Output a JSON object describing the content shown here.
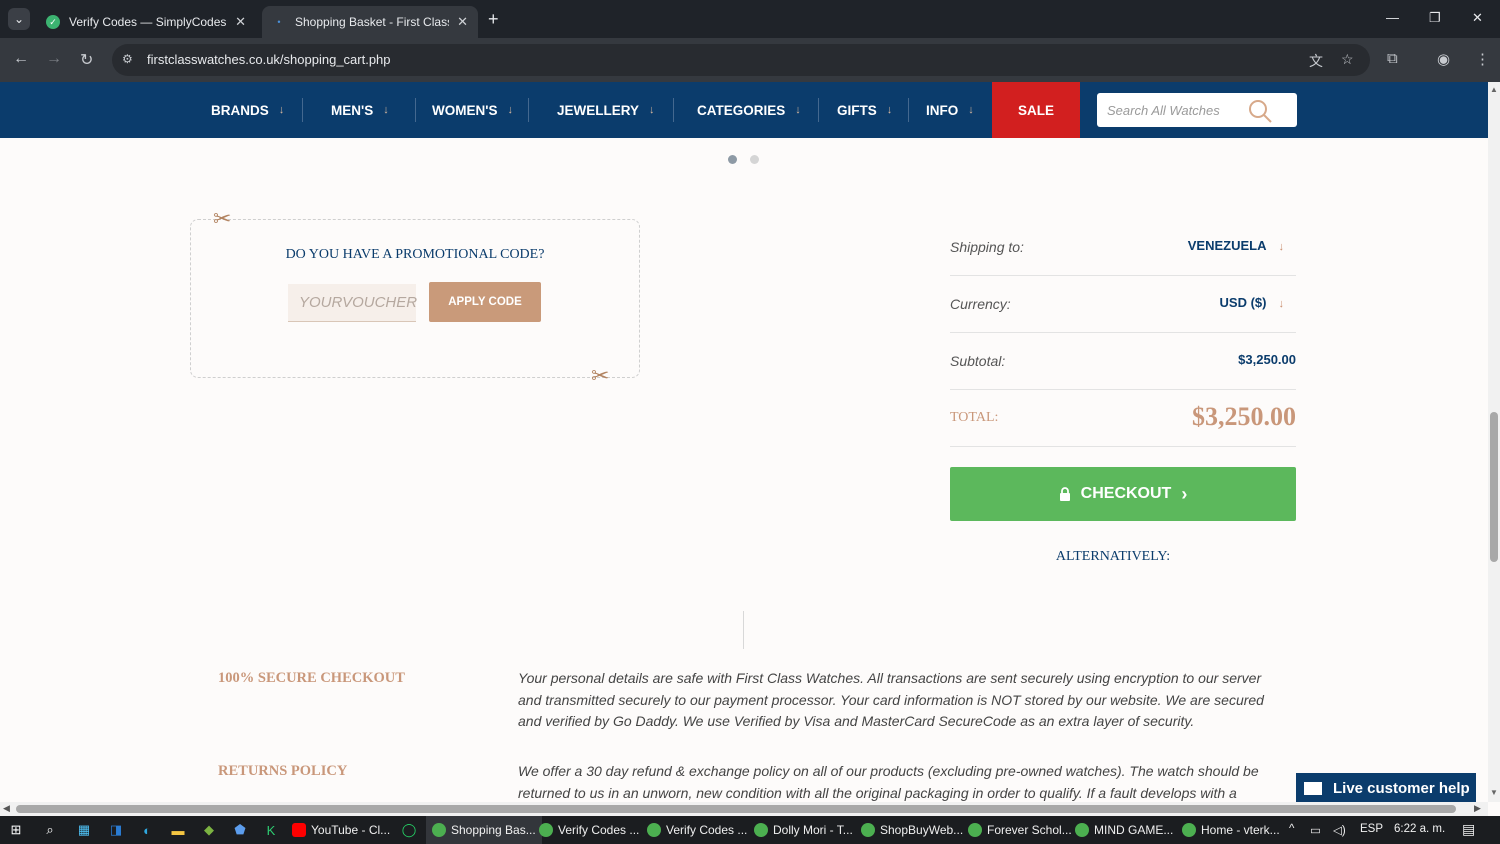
{
  "browser": {
    "tabs": [
      {
        "title": "Verify Codes — SimplyCodes",
        "active": false
      },
      {
        "title": "Shopping Basket - First Class W",
        "active": true
      }
    ],
    "url": "firstclasswatches.co.uk/shopping_cart.php"
  },
  "site_nav": {
    "items": [
      {
        "label": "BRANDS"
      },
      {
        "label": "MEN'S"
      },
      {
        "label": "WOMEN'S"
      },
      {
        "label": "JEWELLERY"
      },
      {
        "label": "CATEGORIES"
      },
      {
        "label": "GIFTS"
      },
      {
        "label": "INFO"
      }
    ],
    "sale_label": "SALE",
    "search_placeholder": "Search All Watches",
    "colors": {
      "nav_bg": "#0b3c6c",
      "sale_bg": "#d21f1f"
    }
  },
  "promo": {
    "title": "DO YOU HAVE A PROMOTIONAL CODE?",
    "voucher_placeholder": "YOURVOUCHER",
    "apply_label": "APPLY CODE"
  },
  "summary": {
    "shipping_label": "Shipping to:",
    "shipping_value": "VENEZUELA",
    "currency_label": "Currency:",
    "currency_value": "USD ($)",
    "subtotal_label": "Subtotal:",
    "subtotal_value": "$3,250.00",
    "total_label": "TOTAL:",
    "total_value": "$3,250.00"
  },
  "checkout": {
    "label": "CHECKOUT",
    "alternatively": "ALTERNATIVELY:",
    "color": "#5cb85c"
  },
  "info": [
    {
      "heading": "100% SECURE CHECKOUT",
      "text": "Your personal details are safe with First Class Watches. All transactions are sent securely using encryption to our server and transmitted securely to our payment processor. Your card information is NOT stored by our website. We are secured and verified by Go Daddy. We use Verified by Visa and MasterCard SecureCode as an extra layer of security."
    },
    {
      "heading": "RETURNS POLICY",
      "text": "We offer a 30 day refund & exchange policy on all of our products (excluding pre-owned watches). The watch should be returned to us in an unworn, new condition with all the original packaging in order to qualify. If a fault develops with a"
    }
  ],
  "live_help": "Live customer help",
  "taskbar": {
    "items": [
      {
        "label": "YouTube - Cl..."
      },
      {
        "label": "Shopping Bas...",
        "active": true
      },
      {
        "label": "Verify Codes ..."
      },
      {
        "label": "Verify Codes ..."
      },
      {
        "label": "Dolly Mori - T..."
      },
      {
        "label": "ShopBuyWeb..."
      },
      {
        "label": "Forever Schol..."
      },
      {
        "label": "MIND GAME..."
      },
      {
        "label": "Home - vterk..."
      }
    ],
    "language": "ESP",
    "time": "6:22 a. m."
  }
}
